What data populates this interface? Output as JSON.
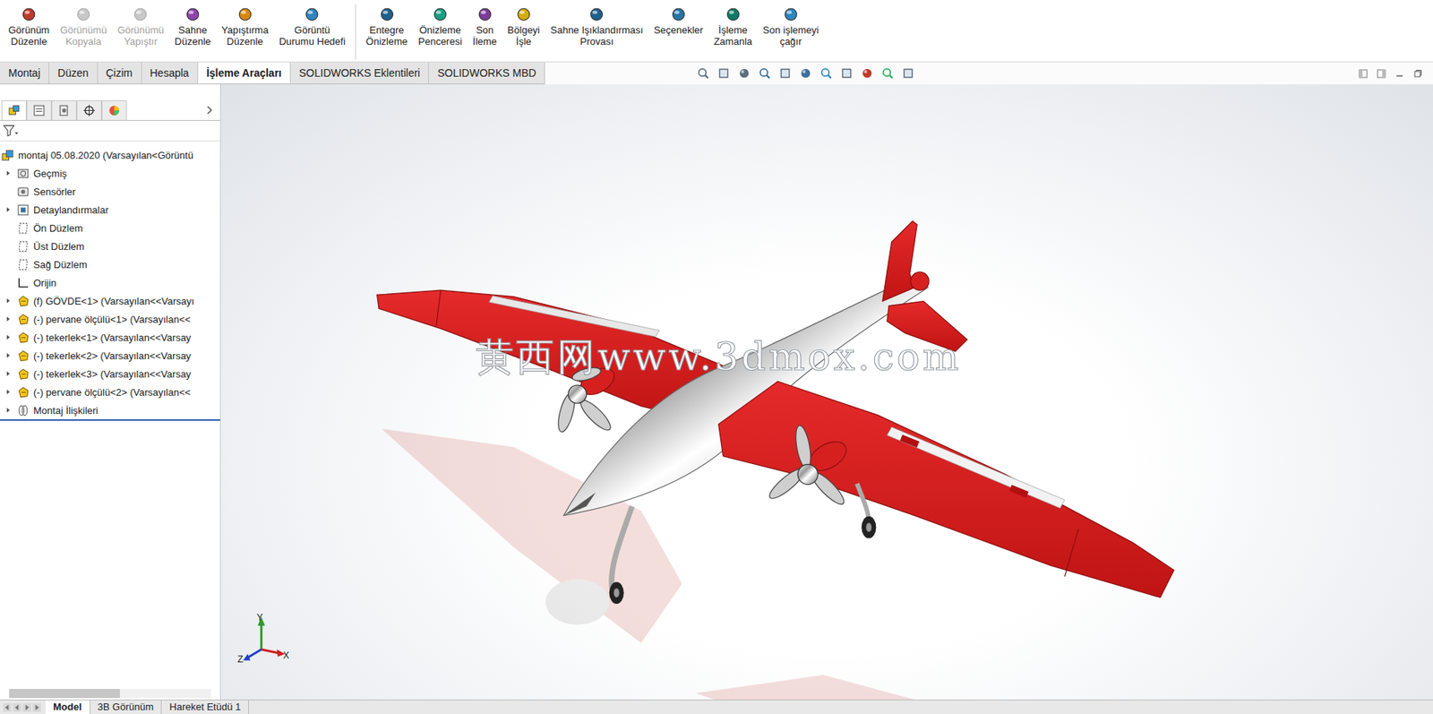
{
  "window": {
    "title": "montaj 05.08.2020"
  },
  "ribbon": {
    "groups": [
      [
        {
          "lines": [
            "Görünüm",
            "Düzenle"
          ],
          "disabled": false
        },
        {
          "lines": [
            "Görünümü",
            "Kopyala"
          ],
          "disabled": true
        },
        {
          "lines": [
            "Görünümü",
            "Yapıştır"
          ],
          "disabled": true
        },
        {
          "lines": [
            "Sahne",
            "Düzenle"
          ],
          "disabled": false
        },
        {
          "lines": [
            "Yapıştırma",
            "Düzenle"
          ],
          "disabled": false
        },
        {
          "lines": [
            "Görüntü",
            "Durumu Hedefi"
          ],
          "disabled": false
        }
      ],
      [
        {
          "lines": [
            "Entegre",
            "Önizleme"
          ],
          "disabled": false
        },
        {
          "lines": [
            "Önizleme",
            "Penceresi"
          ],
          "disabled": false
        },
        {
          "lines": [
            "Son",
            "İleme"
          ],
          "disabled": false
        },
        {
          "lines": [
            "Bölgeyi",
            "İşle"
          ],
          "disabled": false
        },
        {
          "lines": [
            "Sahne Işıklandırması",
            "Provası"
          ],
          "disabled": false
        },
        {
          "lines": [
            "Seçenekler"
          ],
          "disabled": false
        },
        {
          "lines": [
            "İşleme",
            "Zamanla"
          ],
          "disabled": false
        },
        {
          "lines": [
            "Son işlemeyi",
            "çağır"
          ],
          "disabled": false
        }
      ]
    ]
  },
  "tabs": [
    {
      "label": "Montaj",
      "selected": false
    },
    {
      "label": "Düzen",
      "selected": false
    },
    {
      "label": "Çizim",
      "selected": false
    },
    {
      "label": "Hesapla",
      "selected": false
    },
    {
      "label": "İşleme Araçları",
      "selected": true
    },
    {
      "label": "SOLIDWORKS Eklentileri",
      "selected": false
    },
    {
      "label": "SOLIDWORKS MBD",
      "selected": false
    }
  ],
  "panel_tabs": [
    {
      "selected": true
    },
    {
      "selected": false
    },
    {
      "selected": false
    },
    {
      "selected": false
    },
    {
      "selected": false
    }
  ],
  "feature_tree": {
    "root": {
      "label": "montaj 05.08.2020  (Varsayılan<Görüntü",
      "kind": "assembly"
    },
    "items": [
      {
        "label": "Geçmiş",
        "kind": "history",
        "expandable": true
      },
      {
        "label": "Sensörler",
        "kind": "sensor",
        "expandable": false
      },
      {
        "label": "Detaylandırmalar",
        "kind": "annotation",
        "expandable": true
      },
      {
        "label": "Ön Düzlem",
        "kind": "plane",
        "expandable": false
      },
      {
        "label": "Üst Düzlem",
        "kind": "plane",
        "expandable": false
      },
      {
        "label": "Sağ Düzlem",
        "kind": "plane",
        "expandable": false
      },
      {
        "label": "Orijin",
        "kind": "origin",
        "expandable": false
      },
      {
        "label": "(f) GÖVDE<1> (Varsayılan<<Varsayı",
        "kind": "part",
        "expandable": true
      },
      {
        "label": "(-) pervane ölçülü<1> (Varsayılan<<",
        "kind": "part",
        "expandable": true
      },
      {
        "label": "(-) tekerlek<1> (Varsayılan<<Varsay",
        "kind": "part",
        "expandable": true
      },
      {
        "label": "(-) tekerlek<2> (Varsayılan<<Varsay",
        "kind": "part",
        "expandable": true
      },
      {
        "label": "(-) tekerlek<3> (Varsayılan<<Varsay",
        "kind": "part",
        "expandable": true
      },
      {
        "label": "(-) pervane ölçülü<2> (Varsayılan<<",
        "kind": "part",
        "expandable": true
      },
      {
        "label": "Montaj İlişkileri",
        "kind": "mates",
        "expandable": true
      }
    ]
  },
  "panel_scrollbar": {
    "level": 0.55
  },
  "viewport": {
    "watermark": "黄西网www.3dmox.com",
    "triad": {
      "x": "X",
      "y": "Y",
      "z": "Z"
    }
  },
  "bottom_tabs": [
    {
      "label": "Model",
      "selected": true
    },
    {
      "label": "3B Görünüm",
      "selected": false
    },
    {
      "label": "Hareket Etüdü 1",
      "selected": false
    }
  ]
}
